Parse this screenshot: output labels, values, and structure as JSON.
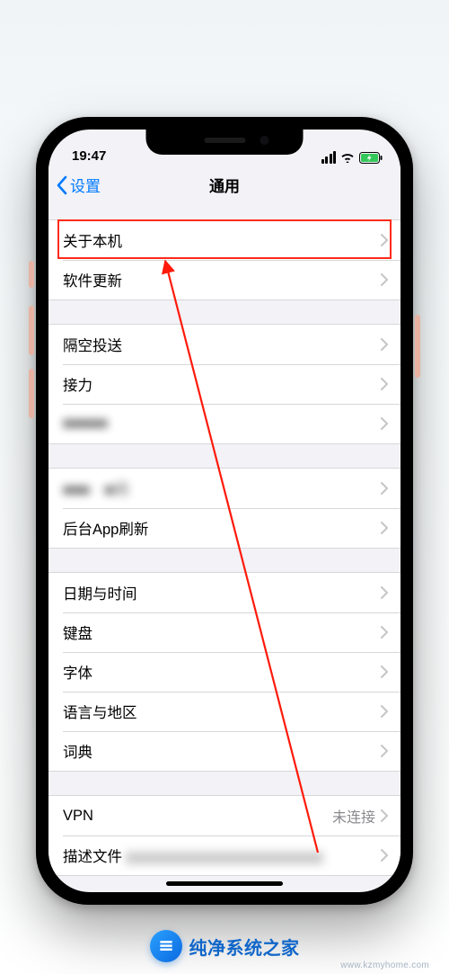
{
  "status": {
    "time": "19:47"
  },
  "nav": {
    "back_label": "设置",
    "title": "通用"
  },
  "groups": [
    {
      "cells": [
        {
          "label": "关于本机",
          "blurred": false,
          "highlighted": true
        },
        {
          "label": "软件更新",
          "blurred": false
        }
      ]
    },
    {
      "cells": [
        {
          "label": "隔空投送",
          "blurred": false
        },
        {
          "label": "接力",
          "blurred": false
        },
        {
          "label": "■■■■■",
          "blurred": true
        }
      ]
    },
    {
      "cells": [
        {
          "label": "■■■　■间",
          "blurred": true
        },
        {
          "label": "后台App刷新",
          "blurred": false
        }
      ]
    },
    {
      "cells": [
        {
          "label": "日期与时间",
          "blurred": false
        },
        {
          "label": "键盘",
          "blurred": false
        },
        {
          "label": "字体",
          "blurred": false
        },
        {
          "label": "语言与地区",
          "blurred": false
        },
        {
          "label": "词典",
          "blurred": false
        }
      ]
    },
    {
      "cells": [
        {
          "label": "VPN",
          "value": "未连接",
          "blurred": false
        },
        {
          "label": "描述文件",
          "blurred": true
        }
      ]
    }
  ],
  "watermark": {
    "text": "纯净系统之家",
    "url": "www.kzmyhome.com"
  }
}
